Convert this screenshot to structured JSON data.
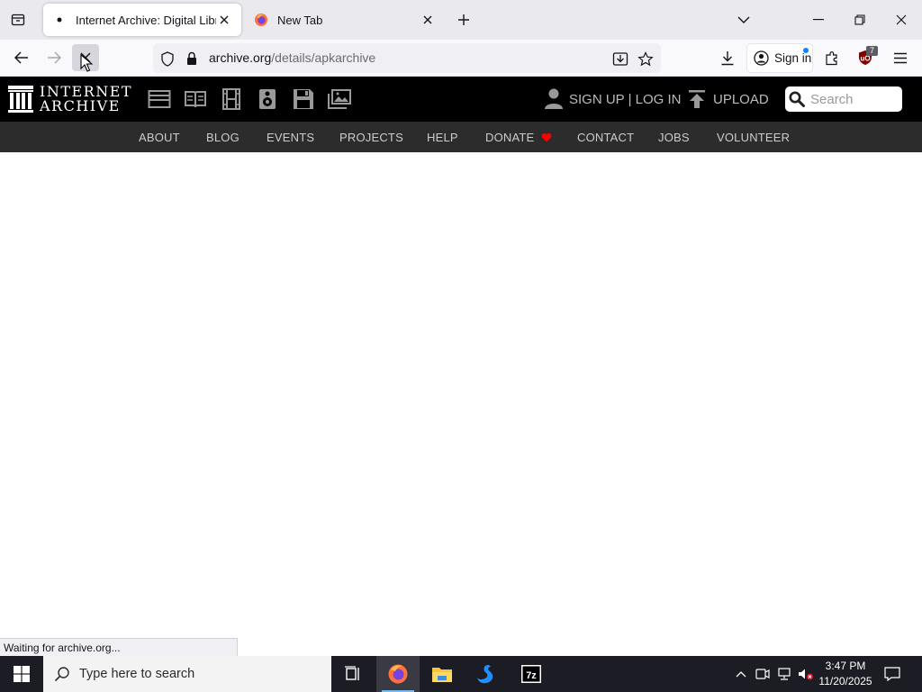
{
  "browser": {
    "tabs": [
      {
        "title": "Internet Archive: Digital Library",
        "active": true
      },
      {
        "title": "New Tab",
        "active": false
      }
    ],
    "url": {
      "domain": "archive.org",
      "path": "/details/apkarchive"
    },
    "sign_in_label": "Sign in",
    "ublock_count": "7",
    "status_text": "Waiting for archive.org..."
  },
  "ia": {
    "logo_line1": "INTERNET",
    "logo_line2": "ARCHIVE",
    "account_label": "SIGN UP | LOG IN",
    "upload_label": "UPLOAD",
    "search_placeholder": "Search",
    "nav": [
      "ABOUT",
      "BLOG",
      "EVENTS",
      "PROJECTS",
      "HELP",
      "DONATE",
      "CONTACT",
      "JOBS",
      "VOLUNTEER"
    ]
  },
  "taskbar": {
    "search_placeholder": "Type here to search",
    "time": "3:47 PM",
    "date": "11/20/2025"
  },
  "colors": {
    "ia_black": "#000000",
    "ia_subnav": "#2c2c2c",
    "donate_heart": "#ff0000",
    "firefox_blue": "#0a84ff"
  }
}
